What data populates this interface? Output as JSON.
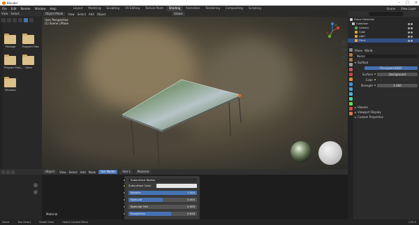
{
  "window": {
    "title": "Blender"
  },
  "menu": {
    "items": [
      "File",
      "Edit",
      "Render",
      "Window",
      "Help"
    ],
    "workspaces": [
      "Layout",
      "Modeling",
      "Sculpting",
      "UV Editing",
      "Texture Paint",
      "Shading",
      "Animation",
      "Rendering",
      "Compositing",
      "Scripting"
    ],
    "active_workspace": "Shading",
    "scene": "Scene",
    "view_layer": "View Layer"
  },
  "file_browser": {
    "header": [
      "View",
      "Select"
    ],
    "folders": [
      "Package",
      "Program Files",
      "Program Files...",
      "Users",
      "Windows"
    ]
  },
  "viewport": {
    "mode": "Object Mode",
    "menus": [
      "View",
      "Select",
      "Add",
      "Object"
    ],
    "shading": "Global",
    "info_line1": "User Perspective",
    "info_line2": "(1) Scene | Plane"
  },
  "outliner": {
    "title": "Scene Collection",
    "items": [
      {
        "label": "Collection",
        "color": "#bbbbbb"
      },
      {
        "label": "Camera",
        "color": "#59a65a"
      },
      {
        "label": "Cube",
        "color": "#e3a43a"
      },
      {
        "label": "Light",
        "color": "#e3a43a"
      },
      {
        "label": "Plane",
        "color": "#e3a43a"
      }
    ]
  },
  "properties": {
    "object": "Plane",
    "world": "World",
    "search": "Name",
    "panel_surface": "Surface",
    "surface_button": "Principled BSDF",
    "rows": [
      {
        "label": "Surface",
        "value": "Background"
      },
      {
        "label": "Color",
        "value": ""
      },
      {
        "label": "Strength",
        "value": "1.000"
      }
    ],
    "sections": [
      "Volume",
      "Viewport Display",
      "Custom Properties"
    ]
  },
  "shader_editor": {
    "menus": [
      "Object",
      "View",
      "Select",
      "Add",
      "Node"
    ],
    "use_nodes": "Use Nodes",
    "slot": "Slot 1",
    "material": "Material",
    "node_rows": [
      {
        "label": "Subsurface Radius",
        "type": "dropdown"
      },
      {
        "label": "Subsurface Color",
        "type": "color"
      }
    ],
    "sliders": [
      {
        "label": "Metallic",
        "value": "1.000",
        "fill": 1.0
      },
      {
        "label": "Specular",
        "value": "0.500",
        "fill": 0.5
      },
      {
        "label": "Specular Tint",
        "value": "0.000",
        "fill": 0.0
      },
      {
        "label": "Roughness",
        "value": "0.618",
        "fill": 0.618
      }
    ],
    "bottom_label": "Material"
  },
  "statusbar": {
    "items": [
      "Select",
      "Box Select",
      "Rotate View",
      "Object Context Menu"
    ],
    "version": "2.92.0"
  }
}
